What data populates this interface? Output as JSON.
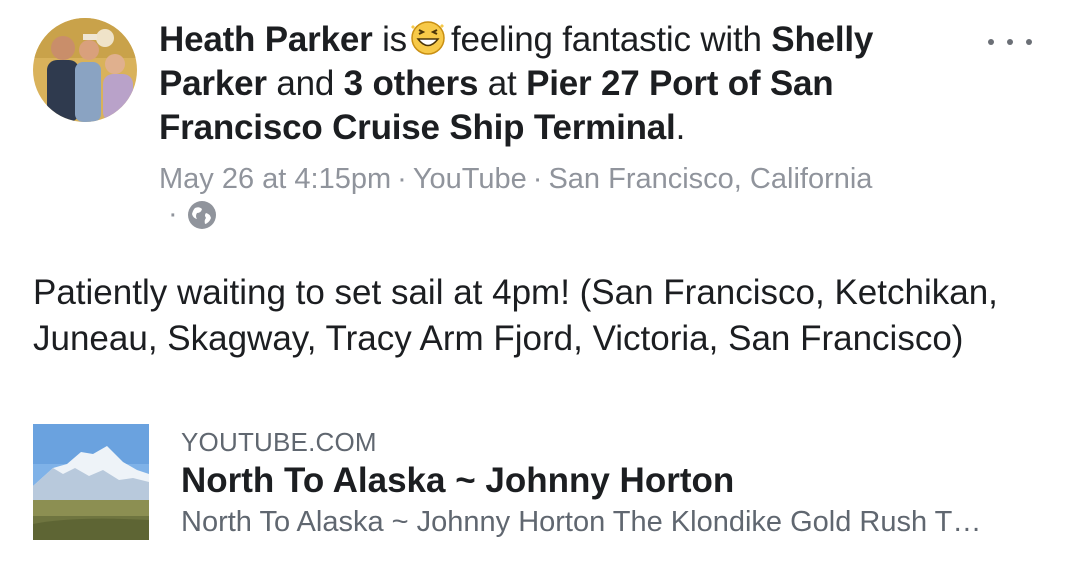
{
  "post": {
    "author": "Heath Parker",
    "verb_is": "is",
    "feeling_icon": "grinning-squint-face-emoji",
    "feeling_text": "feeling fantastic with",
    "tagged_friend": "Shelly Parker",
    "word_and": "and",
    "others": "3 others",
    "word_at": "at",
    "location": "Pier 27 Port of San Francisco Cruise Ship Terminal",
    "period": ".",
    "meta": {
      "timestamp": "May 26 at 4:15pm",
      "separator": "·",
      "source": "YouTube",
      "place": "San Francisco, California",
      "privacy_icon": "globe-icon"
    },
    "more_icon": "ellipsis-icon",
    "body": "Patiently waiting to set sail at 4pm! (San Francisco, Ketchikan, Juneau, Skagway, Tracy Arm Fjord, Victoria, San Francisco)"
  },
  "link_preview": {
    "domain": "YOUTUBE.COM",
    "title": "North To Alaska ~ Johnny Horton",
    "description": "North To Alaska ~ Johnny Horton The Klondike Gold Rush T…",
    "thumbnail_icon": "mountain-thumbnail"
  }
}
